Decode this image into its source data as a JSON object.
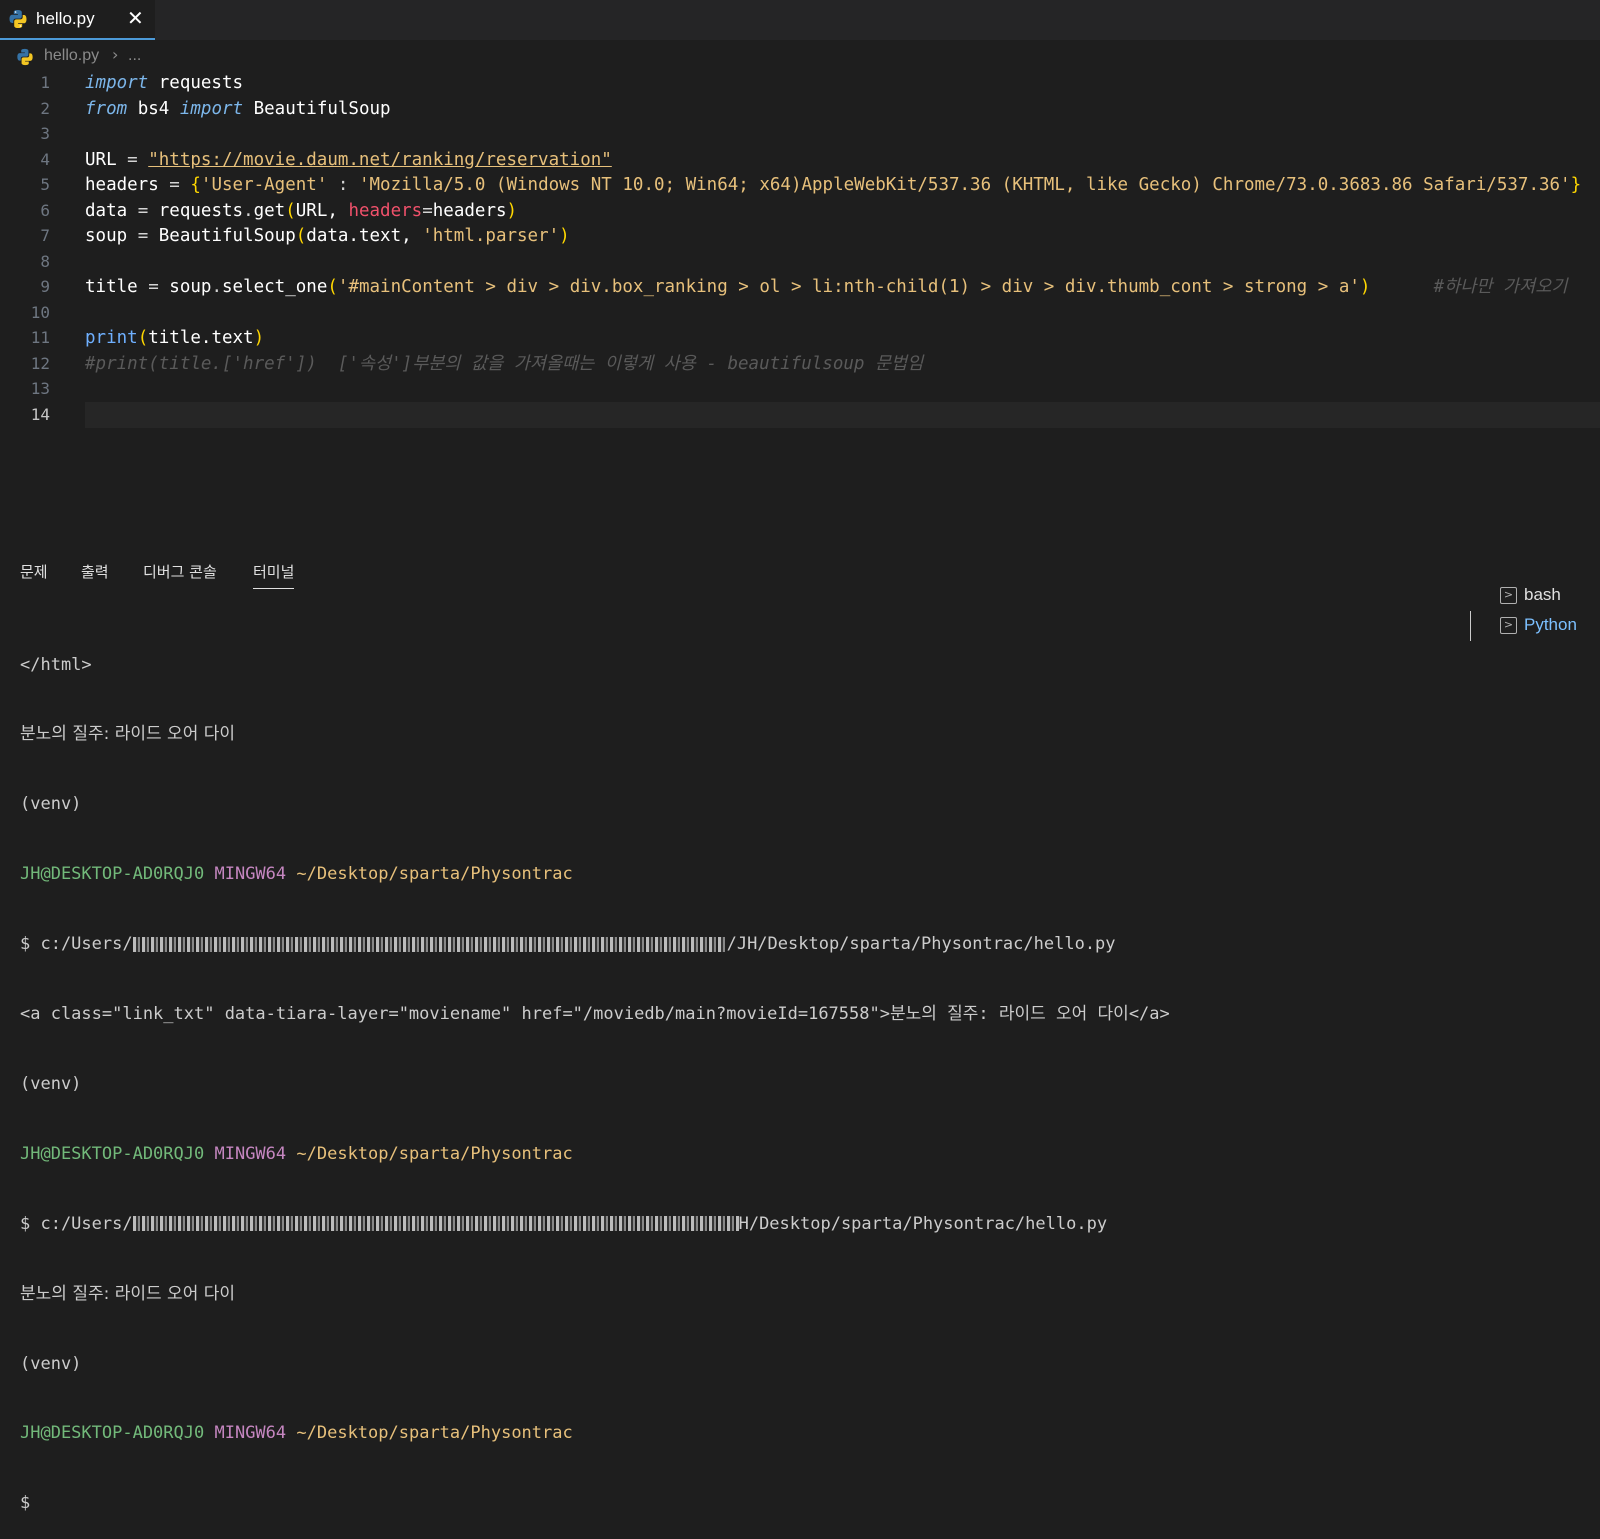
{
  "tab": {
    "filename": "hello.py",
    "close": "✕"
  },
  "breadcrumb": {
    "file": "hello.py",
    "sep": "›",
    "rest": "..."
  },
  "editor": {
    "line_numbers": [
      "1",
      "2",
      "3",
      "4",
      "5",
      "6",
      "7",
      "8",
      "9",
      "10",
      "11",
      "12",
      "13",
      "14"
    ],
    "line1": {
      "kw_import": "import",
      "mod": " requests"
    },
    "line2": {
      "kw_from": "from",
      "mod": " bs4 ",
      "kw_import": "import",
      "cls": " BeautifulSoup"
    },
    "line4": {
      "var": "URL",
      "eq": " = ",
      "url": "\"https://movie.daum.net/ranking/reservation\""
    },
    "line5": {
      "var": "headers",
      "eq": " = ",
      "brace_open": "{",
      "key": "'User-Agent'",
      "colon": " : ",
      "val": "'Mozilla/5.0 (Windows NT 10.0; Win64; x64)AppleWebKit/537.36 (KHTML, like Gecko) Chrome/73.0.3683.86 Safari/537.36'",
      "brace_close": "}"
    },
    "line6": {
      "var": "data",
      "eq": " = ",
      "obj": "requests",
      "dot": ".",
      "fn": "get",
      "po": "(",
      "arg1": "URL, ",
      "kw": "headers",
      "as": "=",
      "arg2": "headers",
      "pc": ")"
    },
    "line7": {
      "var": "soup",
      "eq": " = ",
      "fn": "BeautifulSoup",
      "po": "(",
      "arg1": "data.text, ",
      "arg2": "'html.parser'",
      "pc": ")"
    },
    "line9": {
      "var": "title",
      "eq": " = ",
      "obj": "soup",
      "dot": ".",
      "fn": "select_one",
      "po": "(",
      "arg": "'#mainContent > div > div.box_ranking > ol > li:nth-child(1) > div > div.thumb_cont > strong > a'",
      "pc": ")",
      "gap": "      ",
      "comment": "#하나만 가져오기"
    },
    "line11": {
      "fn": "print",
      "po": "(",
      "arg": "title.text",
      "pc": ")"
    },
    "line12": {
      "comment": "#print(title.['href'])  ['속성']부분의 값을 가져올때는 이렇게 사용 - beautifulsoup 문법임"
    }
  },
  "panel": {
    "tabs": [
      "문제",
      "출력",
      "디버그 콘솔",
      "터미널"
    ],
    "terminals": [
      {
        "name": "bash"
      },
      {
        "name": "Python"
      }
    ]
  },
  "terminal": {
    "l1": "</html>",
    "l2": "분노의 질주: 라이드 오어 다이",
    "l3": "(venv)",
    "prompt_user": "JH@DESKTOP-AD0RQJ0",
    "prompt_env": "MINGW64",
    "prompt_path": "~/Desktop/sparta/Physontrac",
    "cmd_prefix": "$ c:/Users/",
    "cmd1_suffix": "/JH/Desktop/sparta/Physontrac/hello.py",
    "out_a": "<a class=\"link_txt\" data-tiara-layer=\"moviename\" href=\"/moviedb/main?movieId=167558\">분노의 질주: 라이드 오어 다이</a>",
    "cmd2_suffix": "H/Desktop/sparta/Physontrac/hello.py",
    "movie": "분노의 질주: 라이드 오어 다이",
    "venv": "(venv)",
    "dollar": "$"
  }
}
